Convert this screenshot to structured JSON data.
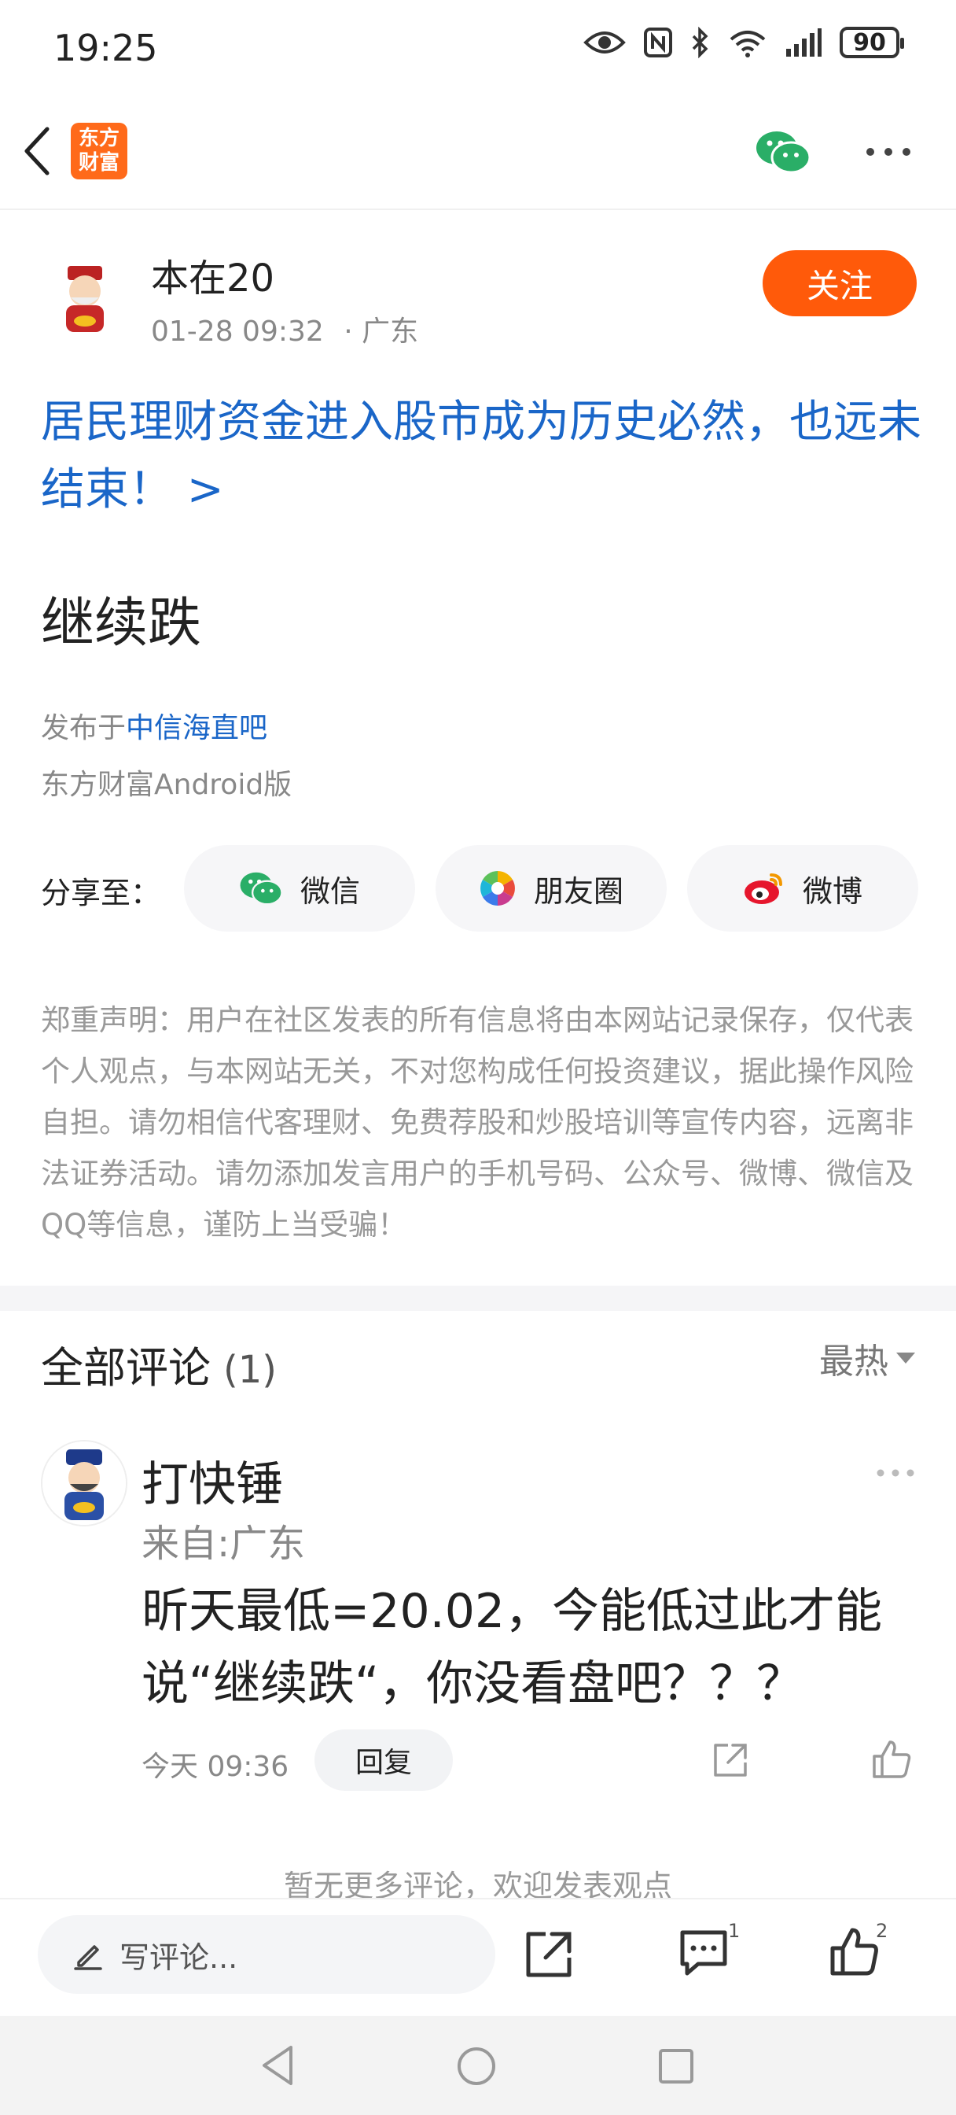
{
  "status_bar": {
    "time": "19:25",
    "battery": "90"
  },
  "header": {
    "logo_text": "东方财富"
  },
  "post": {
    "author": "本在20",
    "date": "01-28 09:32",
    "location": "· 广东",
    "follow_label": "关注",
    "link_title": "居民理财资金进入股市成为历史必然，也远未结束！ >",
    "body": "继续跌",
    "published_prefix": "发布于",
    "bar_name": "中信海直吧",
    "client": "东方财富Android版"
  },
  "share": {
    "label": "分享至：",
    "targets": [
      {
        "label": "微信",
        "icon": "wechat-icon"
      },
      {
        "label": "朋友圈",
        "icon": "moments-icon"
      },
      {
        "label": "微博",
        "icon": "weibo-icon"
      }
    ]
  },
  "disclaimer": "郑重声明：用户在社区发表的所有信息将由本网站记录保存，仅代表个人观点，与本网站无关，不对您构成任何投资建议，据此操作风险自担。请勿相信代客理财、免费荐股和炒股培训等宣传内容，远离非法证券活动。请勿添加发言用户的手机号码、公众号、微博、微信及QQ等信息，谨防上当受骗！",
  "comments": {
    "title": "全部评论",
    "count": "(1)",
    "sort": "最热",
    "items": [
      {
        "name": "打快锤",
        "from": "来自:广东",
        "text": "昕天最低=20.02，今能低过此才能说“继续跌“，你没看盘吧？？？",
        "time": "今天 09:36",
        "reply_label": "回复"
      }
    ],
    "empty_text": "暂无更多评论，欢迎发表观点"
  },
  "action_bar": {
    "input_placeholder": "写评论...",
    "comment_badge": "1",
    "like_badge": "2"
  },
  "colors": {
    "accent": "#ff5a0a",
    "link": "#1a66c8",
    "wechat": "#2aae67"
  }
}
